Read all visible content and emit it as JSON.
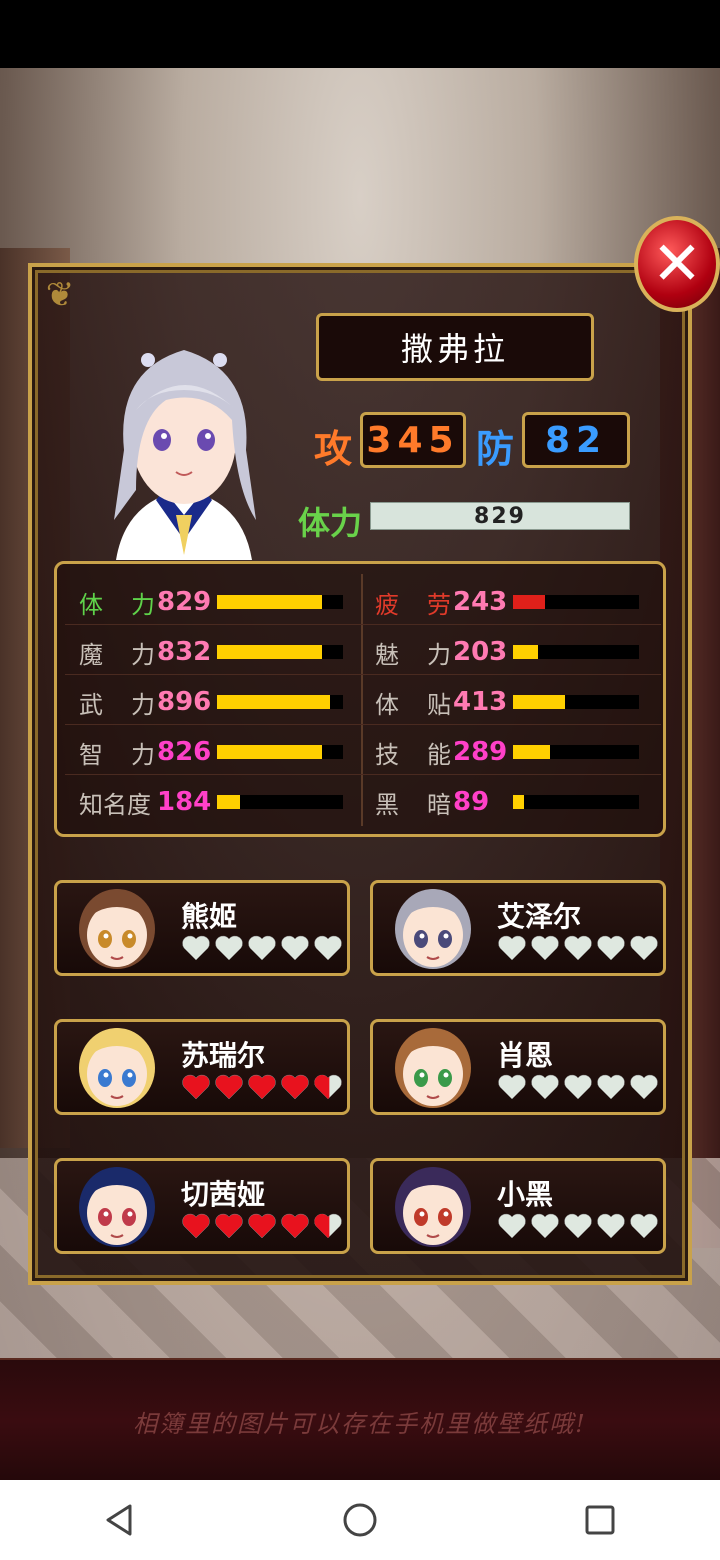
{
  "character": {
    "name": "撒弗拉",
    "atk_label": "攻",
    "atk": "345",
    "def_label": "防",
    "def": "82",
    "hp_label": "体力",
    "hp": "829"
  },
  "stats_left": [
    {
      "label": "体力",
      "value": "829",
      "level": 0.83,
      "label_color": "#5fd24a",
      "value_color": "#ff7ab2"
    },
    {
      "label": "魔力",
      "value": "832",
      "level": 0.83,
      "label_color": "#c8c0b8",
      "value_color": "#ff7ab2"
    },
    {
      "label": "武力",
      "value": "896",
      "level": 0.9,
      "label_color": "#c8c0b8",
      "value_color": "#ff7ab2"
    },
    {
      "label": "智力",
      "value": "826",
      "level": 0.83,
      "label_color": "#c8c0b8",
      "value_color": "#ff40c8"
    },
    {
      "label": "知名度",
      "value": "184",
      "level": 0.18,
      "label_color": "#c8c0b8",
      "value_color": "#ff40c8"
    }
  ],
  "stats_right": [
    {
      "label": "疲劳",
      "value": "243",
      "level": 0.25,
      "red": true,
      "label_color": "#e03a2a",
      "value_color": "#ff7ab2"
    },
    {
      "label": "魅力",
      "value": "203",
      "level": 0.2,
      "label_color": "#c8c0b8",
      "value_color": "#ff7ab2"
    },
    {
      "label": "体贴",
      "value": "413",
      "level": 0.41,
      "label_color": "#c8c0b8",
      "value_color": "#ff7ab2"
    },
    {
      "label": "技能",
      "value": "289",
      "level": 0.29,
      "label_color": "#c8c0b8",
      "value_color": "#ff40c8"
    },
    {
      "label": "黑暗",
      "value": "89",
      "level": 0.09,
      "label_color": "#c8c0b8",
      "value_color": "#ff40c8"
    }
  ],
  "characters": [
    {
      "name": "熊姬",
      "hearts_filled": 0,
      "hair": "#7a4a30",
      "eye": "#c88a2a"
    },
    {
      "name": "艾泽尔",
      "hearts_filled": 0,
      "hair": "#a8a8b8",
      "eye": "#4a4a7a"
    },
    {
      "name": "苏瑞尔",
      "hearts_filled": 4.5,
      "hair": "#f0d070",
      "eye": "#3a7ad0"
    },
    {
      "name": "肖恩",
      "hearts_filled": 0,
      "hair": "#a86a3a",
      "eye": "#3a9a4a"
    },
    {
      "name": "切茜娅",
      "hearts_filled": 4.5,
      "hair": "#1a2a6a",
      "eye": "#c03a4a"
    },
    {
      "name": "小黑",
      "hearts_filled": 0,
      "hair": "#3a2a5a",
      "eye": "#c03a2a"
    }
  ],
  "colors": {
    "gold": "#c9a24a",
    "heart_full": "#e8121e",
    "heart_empty": "#dfe8e0"
  },
  "tip": "相簿里的图片可以存在手机里做壁纸哦!"
}
